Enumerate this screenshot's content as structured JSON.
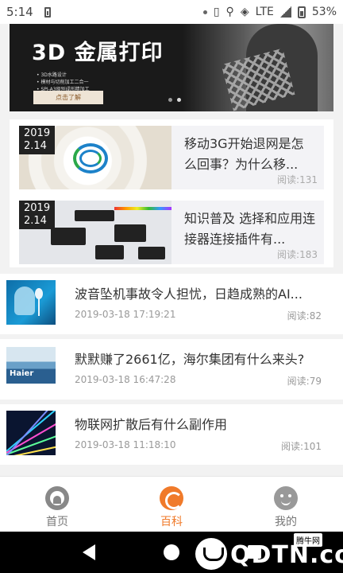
{
  "status_bar": {
    "time": "5:14",
    "network": "LTE",
    "battery": "53%"
  },
  "banner": {
    "title": "3D 金属打印",
    "bullets": [
      "3D水路设计",
      "模材与切削加工二合一",
      "SPI-A3级别成形精加工"
    ],
    "cta": "点击了解",
    "slide_count": 2,
    "active_slide": 1
  },
  "featured": [
    {
      "date_year": "2019",
      "date_day": "2.14",
      "title": "移动3G开始退网是怎么回事？为什么移...",
      "reads": "阅读:131",
      "thumb": "china-mobile-logo"
    },
    {
      "date_year": "2019",
      "date_day": "2.14",
      "title": "知识普及 选择和应用连接器连接插件有...",
      "reads": "阅读:183",
      "thumb": "connector-plugs"
    }
  ],
  "articles": [
    {
      "title": "波音坠机事故令人担忧，日趋成熟的AI...",
      "datetime": "2019-03-18 17:19:21",
      "reads": "阅读:82",
      "thumb": "ai-head"
    },
    {
      "title": "默默赚了2661亿，海尔集团有什么来头?",
      "datetime": "2019-03-18 16:47:28",
      "reads": "阅读:79",
      "thumb": "haier-building",
      "thumb_text": "Haier"
    },
    {
      "title": "物联网扩散后有什么副作用",
      "datetime": "2019-03-18 11:18:10",
      "reads": "阅读:101",
      "thumb": "iot-fiber"
    }
  ],
  "tabbar": {
    "tabs": [
      {
        "label": "首页",
        "icon": "home-icon",
        "active": false
      },
      {
        "label": "百科",
        "icon": "encyclopedia-icon",
        "active": true
      },
      {
        "label": "我的",
        "icon": "profile-icon",
        "active": false
      }
    ],
    "active_color": "#f07a2a"
  },
  "watermark": {
    "text": "QDTN.com",
    "tag": "腾牛网"
  }
}
